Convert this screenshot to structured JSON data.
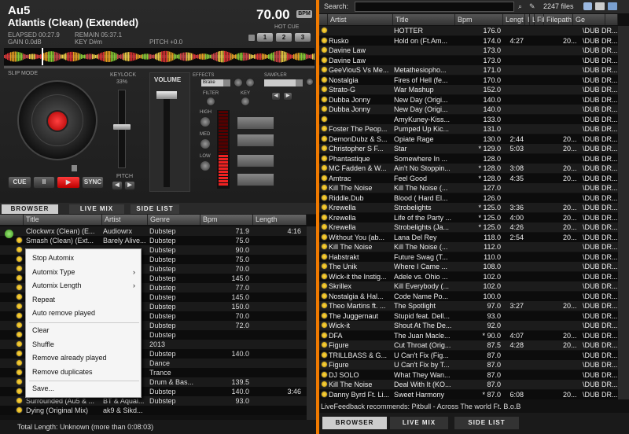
{
  "deck": {
    "artist": "Au5",
    "title": "Atlantis (Clean) (Extended)",
    "bpm": "70.00",
    "bpm_button": "BPM",
    "elapsed": "ELAPSED 00:27.9",
    "remain": "REMAIN 05:37.1",
    "gain": "GAIN 0.0dB",
    "key": "KEY D#m",
    "pitch": "PITCH +0.0",
    "hot_cue_label": "HOT CUE",
    "hot_cues": [
      "1",
      "2",
      "3"
    ],
    "slip_mode": "SLIP MODE",
    "keylock": "KEYLOCK",
    "keylock_pct": "33%",
    "pitch_label": "PITCH",
    "cue": "CUE",
    "pause": "II",
    "sync": "SYNC",
    "volume": "VOLUME",
    "effects": "EFFECTS",
    "effect_selected": "Brake",
    "sampler": "SAMPLER",
    "filter": "FILTER",
    "key_knob": "KEY",
    "high": "HIGH",
    "med": "MED",
    "low": "LOW"
  },
  "left_tabs": [
    "BROWSER",
    "LIVE MIX",
    "SIDE LIST"
  ],
  "left_browser": {
    "headers": [
      "Title",
      "Artist",
      "Genre",
      "Bpm",
      "Length"
    ],
    "rows": [
      {
        "title": "Clockwrx (Clean) (E...",
        "artist": "Audiowrx",
        "genre": "Dubstep",
        "bpm": "71.9",
        "length": "4:16"
      },
      {
        "title": "Smash (Clean) (Ext...",
        "artist": "Barely Alive...",
        "genre": "Dubstep",
        "bpm": "75.0",
        "length": ""
      },
      {
        "title": "",
        "artist": "",
        "genre": "Dubstep",
        "bpm": "90.0",
        "length": ""
      },
      {
        "title": "",
        "artist": "",
        "genre": "Dubstep",
        "bpm": "75.0",
        "length": ""
      },
      {
        "title": "",
        "artist": "",
        "genre": "Dubstep",
        "bpm": "70.0",
        "length": ""
      },
      {
        "title": "",
        "artist": "",
        "genre": "Dubstep",
        "bpm": "145.0",
        "length": ""
      },
      {
        "title": "",
        "artist": "",
        "genre": "Dubstep",
        "bpm": "77.0",
        "length": ""
      },
      {
        "title": "",
        "artist": "",
        "genre": "Dubstep",
        "bpm": "145.0",
        "length": ""
      },
      {
        "title": "",
        "artist": "",
        "genre": "Dubstep",
        "bpm": "150.0",
        "length": ""
      },
      {
        "title": "",
        "artist": "",
        "genre": "Dubstep",
        "bpm": "70.0",
        "length": ""
      },
      {
        "title": "",
        "artist": "",
        "genre": "Dubstep",
        "bpm": "72.0",
        "length": ""
      },
      {
        "title": "",
        "artist": "",
        "genre": "Dubstep",
        "bpm": "",
        "length": ""
      },
      {
        "title": "",
        "artist": "",
        "genre": "2013",
        "bpm": "",
        "length": ""
      },
      {
        "title": "",
        "artist": "",
        "genre": "Dubstep",
        "bpm": "140.0",
        "length": ""
      },
      {
        "title": "",
        "artist": "",
        "genre": "Dance",
        "bpm": "",
        "length": ""
      },
      {
        "title": "",
        "artist": "",
        "genre": "Trance",
        "bpm": "",
        "length": ""
      },
      {
        "title": "",
        "artist": "",
        "genre": "Drum & Bas...",
        "bpm": "139.5",
        "length": ""
      },
      {
        "title": "",
        "artist": "",
        "genre": "Dubstep",
        "bpm": "140.0",
        "length": "3:46"
      },
      {
        "title": "Surrounded (Au5 & ...",
        "artist": "BT & Aqual...",
        "genre": "Dubstep",
        "bpm": "93.0",
        "length": ""
      },
      {
        "title": "Dying (Original Mix)",
        "artist": "ak9 & Sikd...",
        "genre": "",
        "bpm": "",
        "length": ""
      }
    ],
    "total": "Total Length: Unknown (more than 0:08:03)"
  },
  "context_menu": [
    {
      "label": "Stop Automix",
      "submenu": false
    },
    {
      "label": "Automix Type",
      "submenu": true
    },
    {
      "label": "Automix Length",
      "submenu": true
    },
    {
      "label": "Repeat",
      "submenu": false
    },
    {
      "label": "Auto remove played",
      "submenu": false
    },
    {
      "label": "Clear",
      "submenu": false
    },
    {
      "label": "Shuffle",
      "submenu": false
    },
    {
      "label": "Remove already played",
      "submenu": false
    },
    {
      "label": "Remove duplicates",
      "submenu": false
    },
    {
      "label": "Save...",
      "submenu": false
    }
  ],
  "right": {
    "search_label": "Search:",
    "search_value": "",
    "file_count": "2247 files",
    "headers": [
      "Artist",
      "Title",
      "Bpm",
      "Lengt",
      "I",
      "La",
      "Filed",
      "Filepath",
      "Ge"
    ],
    "rows": [
      [
        "",
        "HOTTER",
        "176.0",
        "",
        "",
        "",
        "",
        "\\DUB DR...",
        ""
      ],
      [
        "Rusko",
        "Hold on (Ft.Am...",
        "174.0",
        "4:27",
        "",
        "",
        "20...",
        "\\DUB DR...",
        ""
      ],
      [
        "Davine Law",
        "",
        "173.0",
        "",
        "",
        "",
        "",
        "\\DUB DR...",
        ""
      ],
      [
        "Davine Law",
        "",
        "173.0",
        "",
        "",
        "",
        "",
        "\\DUB DR...",
        ""
      ],
      [
        "GeeViouS Vs Me...",
        "Metathesiopho...",
        "171.0",
        "",
        "",
        "",
        "",
        "\\DUB DR...",
        ""
      ],
      [
        "Nostalgia",
        "Fires of Hell (fe...",
        "170.0",
        "",
        "",
        "",
        "",
        "\\DUB DR...",
        ""
      ],
      [
        "Strato-G",
        "War Mashup",
        "152.0",
        "",
        "",
        "",
        "",
        "\\DUB DR...",
        ""
      ],
      [
        "Dubba Jonny",
        "New Day (Origi...",
        "140.0",
        "",
        "",
        "",
        "",
        "\\DUB DR...",
        ""
      ],
      [
        "Dubba Jonny",
        "New Day (Origi...",
        "140.0",
        "",
        "",
        "",
        "",
        "\\DUB DR...",
        ""
      ],
      [
        "",
        "AmyKuney-Kiss...",
        "133.0",
        "",
        "",
        "",
        "",
        "\\DUB DR...",
        ""
      ],
      [
        "Foster The Peop...",
        "Pumped Up Kic...",
        "131.0",
        "",
        "",
        "",
        "",
        "\\DUB DR...",
        ""
      ],
      [
        "DemonDubz & S...",
        "Opiate Rage",
        "130.0",
        "2:44",
        "",
        "",
        "20...",
        "\\DUB DR...",
        ""
      ],
      [
        "Christopher S F...",
        "Star",
        "* 129.0",
        "5:03",
        "",
        "",
        "20...",
        "\\DUB DR...",
        ""
      ],
      [
        "Phantastique",
        "Somewhere In ...",
        "128.0",
        "",
        "",
        "",
        "",
        "\\DUB DR...",
        ""
      ],
      [
        "MC Fadden & W...",
        "Ain't No Stoppin...",
        "* 128.0",
        "3:08",
        "",
        "",
        "20...",
        "\\DUB DR...",
        ""
      ],
      [
        "Amtrac",
        "Feel Good",
        "* 128.0",
        "4:35",
        "",
        "",
        "20...",
        "\\DUB DR...",
        ""
      ],
      [
        "Kill The Noise",
        "Kill The Noise (...",
        "127.0",
        "",
        "",
        "",
        "",
        "\\DUB DR...",
        ""
      ],
      [
        "Riddle.Dub",
        "Blood ( Hard El...",
        "126.0",
        "",
        "",
        "",
        "",
        "\\DUB DR...",
        ""
      ],
      [
        "Krewella",
        "Strobelights",
        "* 125.0",
        "3:36",
        "",
        "",
        "20...",
        "\\DUB DR...",
        ""
      ],
      [
        "Krewella",
        "Life of the Party ...",
        "* 125.0",
        "4:00",
        "",
        "",
        "20...",
        "\\DUB DR...",
        ""
      ],
      [
        "Krewella",
        "Strobelights (Ja...",
        "* 125.0",
        "4:26",
        "",
        "",
        "20...",
        "\\DUB DR...",
        ""
      ],
      [
        "Without You (ab...",
        "Lana Del Rey",
        "118.0",
        "2:54",
        "",
        "",
        "20...",
        "\\DUB DR...",
        ""
      ],
      [
        "Kill The Noise",
        "Kill The Noise (...",
        "112.0",
        "",
        "",
        "",
        "",
        "\\DUB DR...",
        ""
      ],
      [
        "Habstrakt",
        "Future Swag (T...",
        "110.0",
        "",
        "",
        "",
        "",
        "\\DUB DR...",
        ""
      ],
      [
        "The Unik",
        "Where I Came ...",
        "108.0",
        "",
        "",
        "",
        "",
        "\\DUB DR...",
        ""
      ],
      [
        "Wick-it the Instig...",
        "Adele vs. Ohio ...",
        "102.0",
        "",
        "",
        "",
        "",
        "\\DUB DR...",
        ""
      ],
      [
        "Skrillex",
        "Kill Everybody (...",
        "102.0",
        "",
        "",
        "",
        "",
        "\\DUB DR...",
        ""
      ],
      [
        "Nostalgia & Hal...",
        "Code Name Po...",
        "100.0",
        "",
        "",
        "",
        "",
        "\\DUB DR...",
        ""
      ],
      [
        "Theo Martins ft. ...",
        "The Spotlight",
        "97.0",
        "3:27",
        "",
        "",
        "20...",
        "\\DUB DR...",
        ""
      ],
      [
        "The Juggernaut",
        "Stupid feat. Dell...",
        "93.0",
        "",
        "",
        "",
        "",
        "\\DUB DR...",
        ""
      ],
      [
        "Wick-it",
        "Shout At The De...",
        "92.0",
        "",
        "",
        "",
        "",
        "\\DUB DR...",
        ""
      ],
      [
        "DFA",
        "The Juan Macle...",
        "* 90.0",
        "4:07",
        "",
        "",
        "20...",
        "\\DUB DR...",
        ""
      ],
      [
        "Figure",
        "Cut Throat (Orig...",
        "87.5",
        "4:28",
        "",
        "",
        "20...",
        "\\DUB DR...",
        ""
      ],
      [
        "TRILLBASS & G...",
        "U Can't Fix (Fig...",
        "87.0",
        "",
        "",
        "",
        "",
        "\\DUB DR...",
        ""
      ],
      [
        "Figure",
        "U Can't Fix by T...",
        "87.0",
        "",
        "",
        "",
        "",
        "\\DUB DR...",
        ""
      ],
      [
        "DJ SOLO",
        "What They Wan...",
        "87.0",
        "",
        "",
        "",
        "",
        "\\DUB DR...",
        ""
      ],
      [
        "Kill The Noise",
        "Deal With It (KO...",
        "87.0",
        "",
        "",
        "",
        "",
        "\\DUB DR...",
        ""
      ],
      [
        "Danny Byrd Ft. Li...",
        "Sweet Harmony",
        "* 87.0",
        "6:08",
        "",
        "",
        "20...",
        "\\DUB DR...",
        ""
      ]
    ],
    "feedback": "LiveFeedback recommends: Pitbull - Across The world Ft. B.o.B",
    "tabs": [
      "BROWSER",
      "LIVE MIX",
      "SIDE LIST"
    ]
  }
}
